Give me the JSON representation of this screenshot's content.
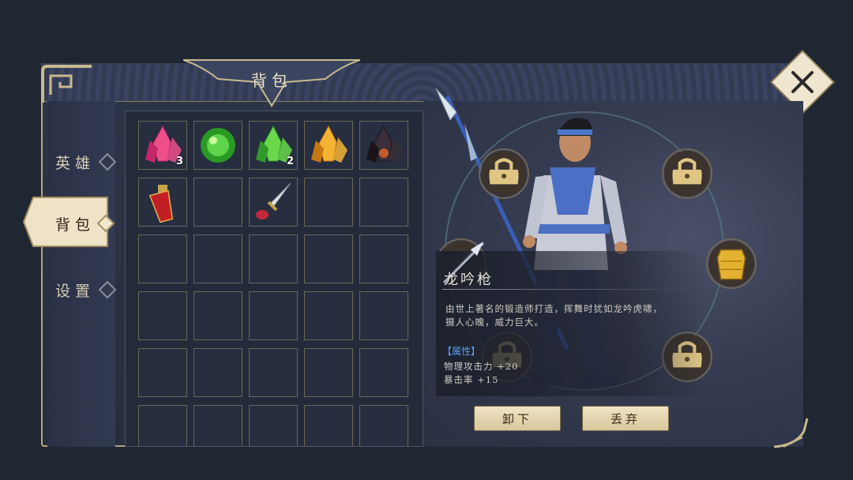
{
  "title": "背包",
  "nav": {
    "items": [
      {
        "label": "英雄",
        "active": false
      },
      {
        "label": "背包",
        "active": true
      },
      {
        "label": "设置",
        "active": false
      }
    ]
  },
  "inventory": {
    "columns": 5,
    "slots": [
      {
        "item": "pink-crystal-icon",
        "count": "3"
      },
      {
        "item": "green-orb-icon",
        "count": ""
      },
      {
        "item": "green-crystal-icon",
        "count": "2"
      },
      {
        "item": "gold-crystal-icon",
        "count": ""
      },
      {
        "item": "dark-crystal-icon",
        "count": ""
      },
      {
        "item": "red-potion-icon",
        "count": ""
      },
      {
        "item": "",
        "count": ""
      },
      {
        "item": "dagger-icon",
        "count": ""
      },
      {
        "item": "",
        "count": ""
      },
      {
        "item": "",
        "count": ""
      }
    ]
  },
  "equipment": {
    "slots": [
      {
        "name": "equip-slot-top-left",
        "icon": "lock-icon"
      },
      {
        "name": "equip-slot-top-right",
        "icon": "lock-icon"
      },
      {
        "name": "equip-slot-mid-left",
        "icon": "spear-icon"
      },
      {
        "name": "equip-slot-mid-right",
        "icon": "armor-icon"
      },
      {
        "name": "equip-slot-bottom-left",
        "icon": "lock-icon"
      },
      {
        "name": "equip-slot-bottom-right",
        "icon": "lock-icon"
      }
    ]
  },
  "item_info": {
    "name": "龙吟枪",
    "description_line1": "由世上著名的锻造师打造，挥舞时犹如龙吟虎啸，",
    "description_line2": "摄人心魄，威力巨大。",
    "attr_title": "【属性】",
    "attr1": "物理攻击力 +20",
    "attr2": "暴击率 +15"
  },
  "buttons": {
    "unequip": "卸下",
    "discard": "丢弃"
  },
  "colors": {
    "gold_trim": "#b5a57e",
    "button_bg": "#e6d8b4",
    "attr_title": "#5aa0f0"
  }
}
